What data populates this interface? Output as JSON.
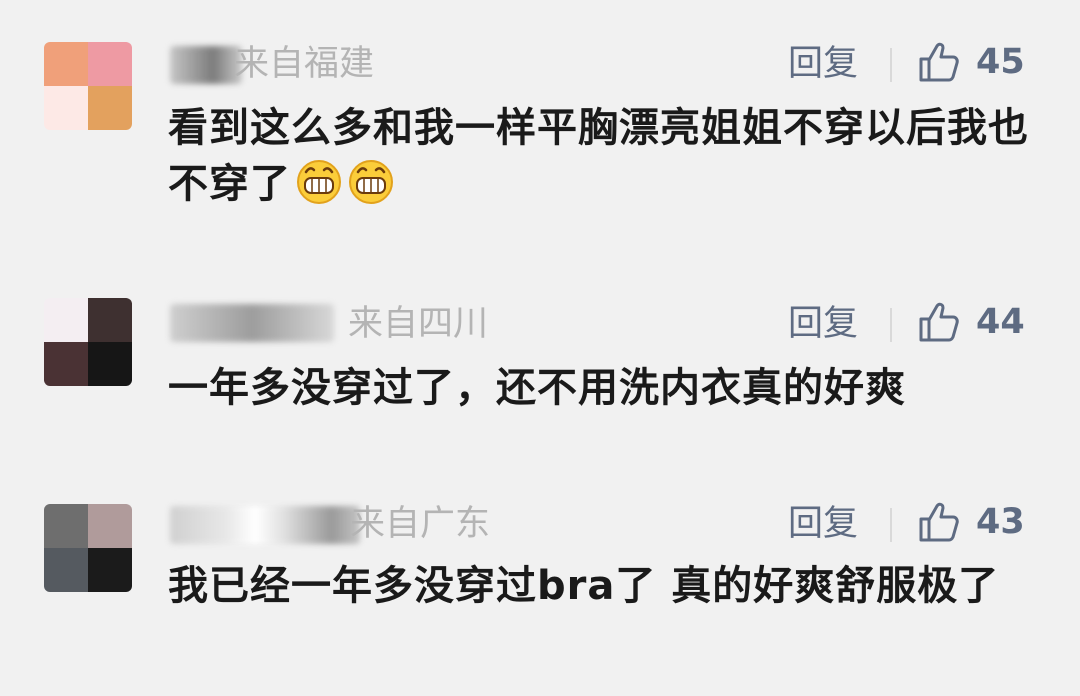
{
  "comments": [
    {
      "location": "来自福建",
      "reply_label": "回复",
      "likes": "45",
      "text": "看到这么多和我一样平胸漂亮姐姐不穿以后我也不穿了",
      "emoji_icons": [
        "grinning-face-icon",
        "grinning-face-icon"
      ],
      "avatar_colors": [
        "#f0a07a",
        "#ee9aa3",
        "#fde9e6",
        "#e3a15e"
      ]
    },
    {
      "location": "来自四川",
      "reply_label": "回复",
      "likes": "44",
      "text": "一年多没穿过了，还不用洗内衣真的好爽",
      "emoji_icons": [],
      "avatar_colors": [
        "#f4eef2",
        "#3e3030",
        "#4a3234",
        "#161616"
      ]
    },
    {
      "location": "来自广东",
      "reply_label": "回复",
      "likes": "43",
      "text": "我已经一年多没穿过bra了 真的好爽舒服极了",
      "emoji_icons": [],
      "avatar_colors": [
        "#6e6e6e",
        "#b09b9b",
        "#555a60",
        "#1b1b1b"
      ]
    }
  ],
  "colors": {
    "action": "#5e6b82",
    "location": "#b4b4b4",
    "text": "#1a1a1a",
    "background": "#f1f1f1"
  }
}
